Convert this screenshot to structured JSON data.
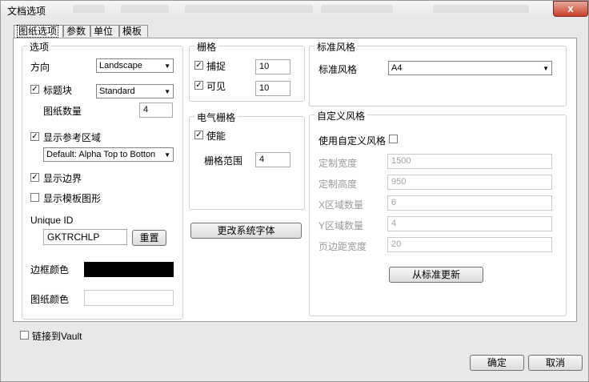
{
  "window": {
    "title": "文档选项",
    "close_glyph": "x"
  },
  "tabs": [
    "图纸选项",
    "参数",
    "单位",
    "模板"
  ],
  "options": {
    "group_label": "选项",
    "orientation_label": "方向",
    "orientation_value": "Landscape",
    "title_block_label": "标题块",
    "title_block_checked": true,
    "title_block_value": "Standard",
    "sheet_count_label": "图纸数量",
    "sheet_count_value": "4",
    "show_ref_zones_label": "显示参考区域",
    "show_ref_zones_checked": true,
    "ref_zones_value": "Default: Alpha Top to Botton",
    "show_border_label": "显示边界",
    "show_border_checked": true,
    "show_template_graphics_label": "显示模板图形",
    "show_template_graphics_checked": false,
    "unique_id_label": "Unique ID",
    "unique_id_value": "GKTRCHLP",
    "reset_button": "重置",
    "border_color_label": "边框颜色",
    "border_color": "#000000",
    "sheet_color_label": "图纸颜色",
    "sheet_color": "#ffffff"
  },
  "grid": {
    "group_label": "栅格",
    "snap_label": "捕捉",
    "snap_checked": true,
    "snap_value": "10",
    "visible_label": "可见",
    "visible_checked": true,
    "visible_value": "10"
  },
  "electrical_grid": {
    "group_label": "电气栅格",
    "enable_label": "使能",
    "enable_checked": true,
    "range_label": "栅格范围",
    "range_value": "4"
  },
  "change_font_button": "更改系统字体",
  "standard_style": {
    "group_label": "标准风格",
    "label": "标准风格",
    "value": "A4"
  },
  "custom_style": {
    "group_label": "自定义风格",
    "use_label": "使用自定义风格",
    "use_checked": false,
    "fields": [
      {
        "label": "定制宽度",
        "value": "1500"
      },
      {
        "label": "定制高度",
        "value": "950"
      },
      {
        "label": "X区域数量",
        "value": "6"
      },
      {
        "label": "Y区域数量",
        "value": "4"
      },
      {
        "label": "页边距宽度",
        "value": "20"
      }
    ],
    "update_button": "从标准更新"
  },
  "link_vault_label": "链接到Vault",
  "link_vault_checked": false,
  "ok_button": "确定",
  "cancel_button": "取消"
}
